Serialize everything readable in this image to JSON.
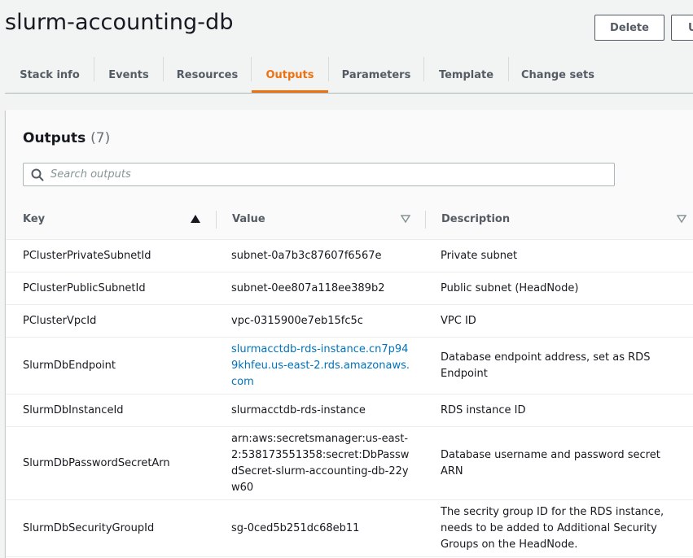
{
  "stack": {
    "title": "slurm-accounting-db",
    "delete_label": "Delete",
    "update_label": "Update"
  },
  "tabs": [
    {
      "label": "Stack info"
    },
    {
      "label": "Events"
    },
    {
      "label": "Resources"
    },
    {
      "label": "Outputs",
      "active": true
    },
    {
      "label": "Parameters"
    },
    {
      "label": "Template"
    },
    {
      "label": "Change sets"
    }
  ],
  "outputs": {
    "title": "Outputs",
    "count": "(7)",
    "search_placeholder": "Search outputs",
    "columns": {
      "key": "Key",
      "value": "Value",
      "description": "Description"
    },
    "rows": [
      {
        "key": "PClusterPrivateSubnetId",
        "value": "subnet-0a7b3c87607f6567e",
        "description": "Private subnet"
      },
      {
        "key": "PClusterPublicSubnetId",
        "value": "subnet-0ee807a118ee389b2",
        "description": "Public subnet (HeadNode)"
      },
      {
        "key": "PClusterVpcId",
        "value": "vpc-0315900e7eb15fc5c",
        "description": "VPC ID"
      },
      {
        "key": "SlurmDbEndpoint",
        "value": "slurmacctdb-rds-instance.cn7p949khfeu.us-east-2.rds.amazonaws.com",
        "description": "Database endpoint address, set as RDS Endpoint"
      },
      {
        "key": "SlurmDbInstanceId",
        "value": "slurmacctdb-rds-instance",
        "description": "RDS instance ID"
      },
      {
        "key": "SlurmDbPasswordSecretArn",
        "value": "arn:aws:secretsmanager:us-east-2:538173551358:secret:DbPasswdSecret-slurm-accounting-db-22yw60",
        "description": "Database username and password secret ARN"
      },
      {
        "key": "SlurmDbSecurityGroupId",
        "value": "sg-0ced5b251dc68eb11",
        "description": "The secrity group ID for the RDS instance, needs to be added to Additional Security Groups on the HeadNode."
      }
    ]
  },
  "colors": {
    "accent": "#ec7211",
    "link": "#0073bb"
  }
}
